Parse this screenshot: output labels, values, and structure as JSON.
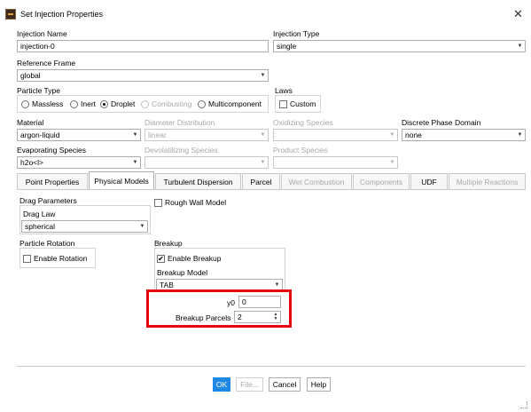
{
  "window": {
    "title": "Set Injection Properties",
    "close_glyph": "✕"
  },
  "injection_name": {
    "label": "Injection Name",
    "value": "injection-0"
  },
  "injection_type": {
    "label": "Injection Type",
    "value": "single"
  },
  "reference_frame": {
    "label": "Reference Frame",
    "value": "global"
  },
  "particle_type": {
    "label": "Particle Type",
    "options": [
      {
        "label": "Massless",
        "selected": false,
        "enabled": true
      },
      {
        "label": "Inert",
        "selected": false,
        "enabled": true
      },
      {
        "label": "Droplet",
        "selected": true,
        "enabled": true
      },
      {
        "label": "Combusting",
        "selected": false,
        "enabled": false
      },
      {
        "label": "Multicomponent",
        "selected": false,
        "enabled": true
      }
    ]
  },
  "laws": {
    "label": "Laws",
    "custom_label": "Custom",
    "custom_checked": false
  },
  "material": {
    "label": "Material",
    "value": "argon-liquid"
  },
  "diameter_distribution": {
    "label": "Diameter Distribution",
    "value": "linear"
  },
  "oxidizing_species": {
    "label": "Oxidizing Species",
    "value": ""
  },
  "discrete_phase_domain": {
    "label": "Discrete Phase Domain",
    "value": "none"
  },
  "evaporating_species": {
    "label": "Evaporating Species",
    "value": "h2o<l>"
  },
  "devolatilizing_species": {
    "label": "Devolatilizing Species",
    "value": ""
  },
  "product_species": {
    "label": "Product Species",
    "value": ""
  },
  "tabs": [
    {
      "label": "Point Properties",
      "active": false,
      "enabled": true
    },
    {
      "label": "Physical Models",
      "active": true,
      "enabled": true
    },
    {
      "label": "Turbulent Dispersion",
      "active": false,
      "enabled": true
    },
    {
      "label": "Parcel",
      "active": false,
      "enabled": true
    },
    {
      "label": "Wet Combustion",
      "active": false,
      "enabled": false
    },
    {
      "label": "Components",
      "active": false,
      "enabled": false
    },
    {
      "label": "UDF",
      "active": false,
      "enabled": true
    },
    {
      "label": "Multiple Reactions",
      "active": false,
      "enabled": false
    }
  ],
  "drag": {
    "group_label": "Drag Parameters",
    "law_label": "Drag Law",
    "law_value": "spherical"
  },
  "rough_wall": {
    "label": "Rough Wall Model",
    "checked": false
  },
  "particle_rotation": {
    "group_label": "Particle Rotation",
    "enable_label": "Enable Rotation",
    "checked": false
  },
  "breakup": {
    "group_label": "Breakup",
    "enable_label": "Enable Breakup",
    "enabled_checked": true,
    "check_glyph": "✔",
    "model_label": "Breakup Model",
    "model_value": "TAB",
    "y0_label": "y0",
    "y0_value": "0",
    "parcels_label": "Breakup Parcels",
    "parcels_value": "2"
  },
  "buttons": {
    "ok": "OK",
    "file": "File...",
    "cancel": "Cancel",
    "help": "Help"
  },
  "icons": {
    "combo_arrow": "▼",
    "spin_up": "▲",
    "spin_down": "▼"
  },
  "colors": {
    "accent": "#1e88e5",
    "highlight": "#e8000b"
  }
}
